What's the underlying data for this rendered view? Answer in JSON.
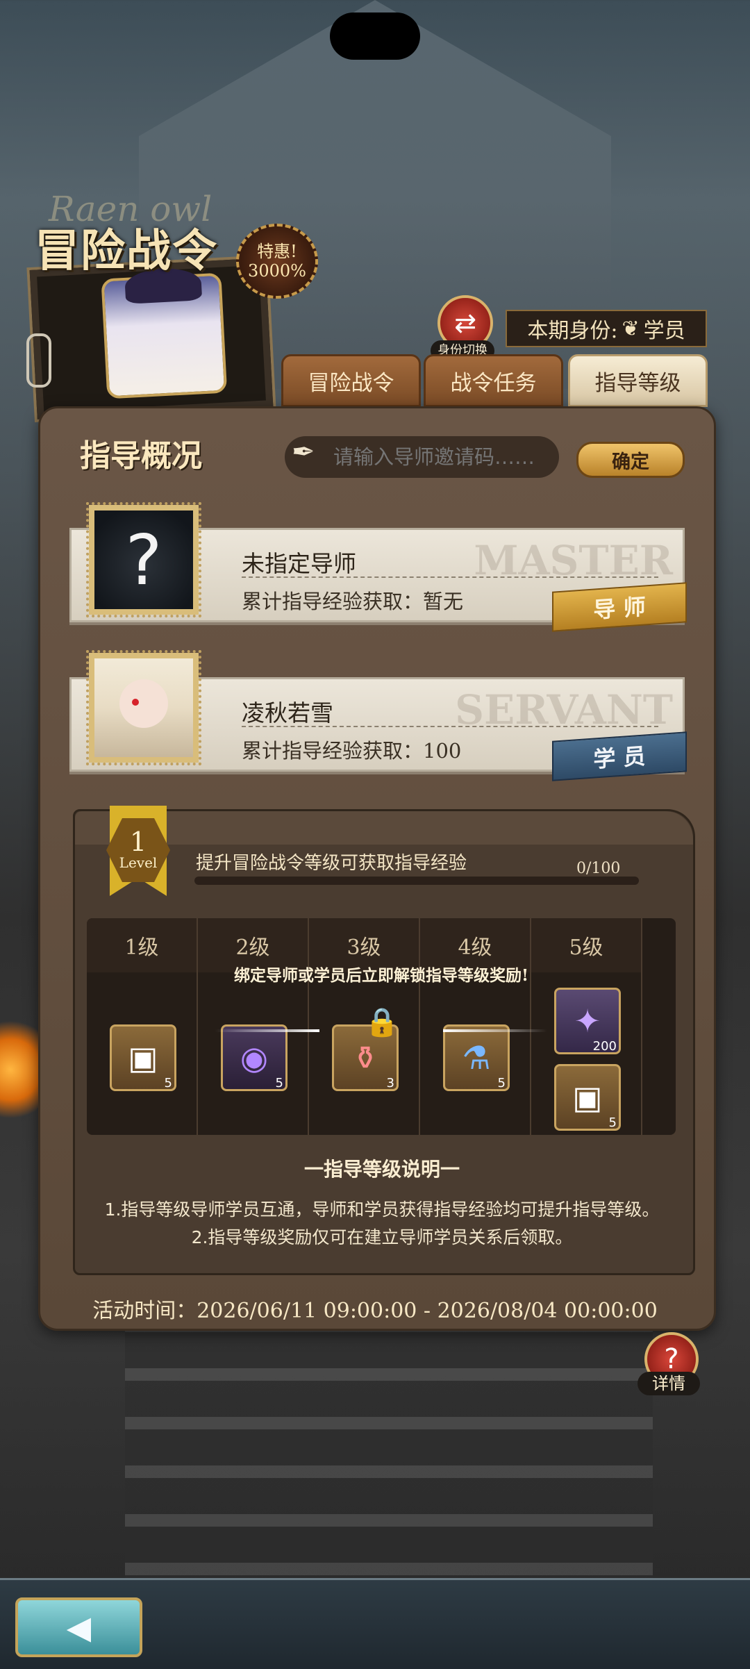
{
  "header": {
    "title": "冒险战令",
    "script": "Raen owl",
    "sale_badge_line1": "特惠!",
    "sale_badge_line2": "3000%",
    "identity_label": "本期身份:",
    "identity_value": "学员",
    "switch_icon": "swap-arrows",
    "switch_label": "身份切换"
  },
  "tabs": [
    {
      "label": "冒险战令",
      "active": false
    },
    {
      "label": "战令任务",
      "active": false
    },
    {
      "label": "指导等级",
      "active": true
    }
  ],
  "overview": {
    "title": "指导概况",
    "invite_placeholder": "请输入导师邀请码……",
    "confirm_label": "确定"
  },
  "mentor_card": {
    "name": "未指定导师",
    "exp_text": "累计指导经验获取：暂无",
    "bg_word": "MASTER",
    "tag": "导 师"
  },
  "student_card": {
    "name": "凌秋若雪",
    "exp_text": "累计指导经验获取：100",
    "bg_word": "SERVANT",
    "tag": "学 员"
  },
  "level": {
    "value": "1",
    "label": "Level",
    "exp_hint": "提升冒险战令等级可获取指导经验",
    "exp_count": "0/100",
    "exp_fraction": 0
  },
  "rewards": {
    "unlock_hint": "绑定导师或学员后立即解锁指导等级奖励!",
    "columns": [
      {
        "label": "1级",
        "items": [
          {
            "icon": "treasure-chest",
            "qty": "5"
          }
        ]
      },
      {
        "label": "2级",
        "items": [
          {
            "icon": "purple-orb",
            "qty": "5"
          }
        ]
      },
      {
        "label": "3级",
        "items": [
          {
            "icon": "potion-vial",
            "qty": "3"
          }
        ]
      },
      {
        "label": "4级",
        "items": [
          {
            "icon": "blue-flask",
            "qty": "5"
          }
        ]
      },
      {
        "label": "5级",
        "items": [
          {
            "icon": "purple-star-crystal",
            "qty": "200"
          },
          {
            "icon": "treasure-chest",
            "qty": "5"
          }
        ]
      }
    ]
  },
  "notes": {
    "title": "一指导等级说明一",
    "line1": "1.指导等级导师学员互通，导师和学员获得指导经验均可提升指导等级。",
    "line2": "2.指导等级奖励仅可在建立导师学员关系后领取。"
  },
  "period": "活动时间：2026/06/11 09:00:00 - 2026/08/04 00:00:00",
  "help": {
    "icon": "question-mark",
    "label": "详情"
  },
  "nav": {
    "back_icon": "back-arrow"
  }
}
